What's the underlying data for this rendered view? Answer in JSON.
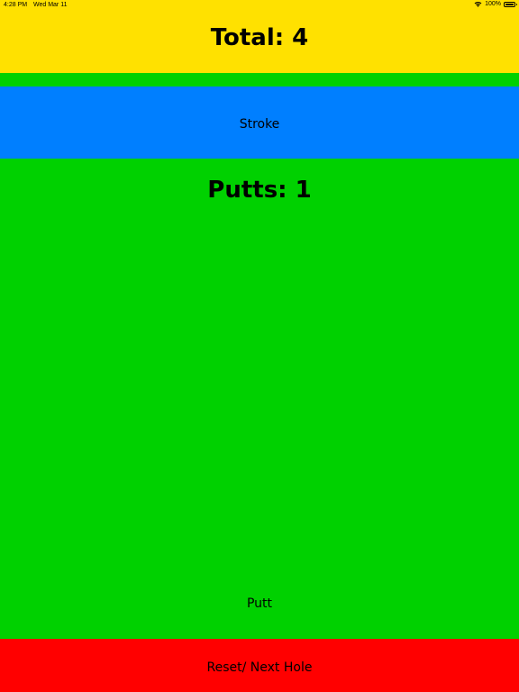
{
  "status_bar": {
    "time": "4:28 PM",
    "date": "Wed Mar 11",
    "battery": "100%",
    "wifi_icon": "wifi-icon",
    "battery_icon": "battery-icon"
  },
  "score": {
    "total_text": "Total: 4",
    "putts_text": "Putts: 1"
  },
  "buttons": {
    "stroke_label": "Stroke",
    "putt_label": "Putt",
    "reset_label": "Reset/ Next Hole"
  },
  "colors": {
    "total_bar": "#ffe100",
    "background": "#00d100",
    "stroke_button": "#007fff",
    "reset_button": "#ff0000"
  }
}
